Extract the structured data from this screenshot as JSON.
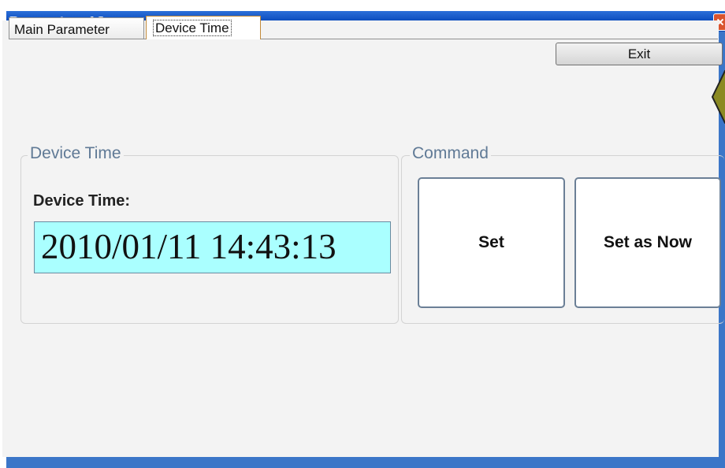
{
  "window": {
    "title": "Parameter- 16"
  },
  "tabs": [
    {
      "label": "Main Parameter",
      "selected": false
    },
    {
      "label": "Device Time",
      "selected": true
    }
  ],
  "toolbar": {
    "exit_label": "Exit"
  },
  "device_time_group": {
    "legend": "Device Time",
    "field_label": "Device Time:",
    "value": "2010/01/11 14:43:13"
  },
  "command_group": {
    "legend": "Command",
    "set_label": "Set",
    "set_now_label": "Set as Now"
  },
  "colors": {
    "titlebar": "#0a43b0",
    "time_field_bg": "#aaffff",
    "legend_text": "#607a96"
  },
  "icons": {
    "close": "close-icon",
    "marker": "arrow-marker-icon"
  }
}
